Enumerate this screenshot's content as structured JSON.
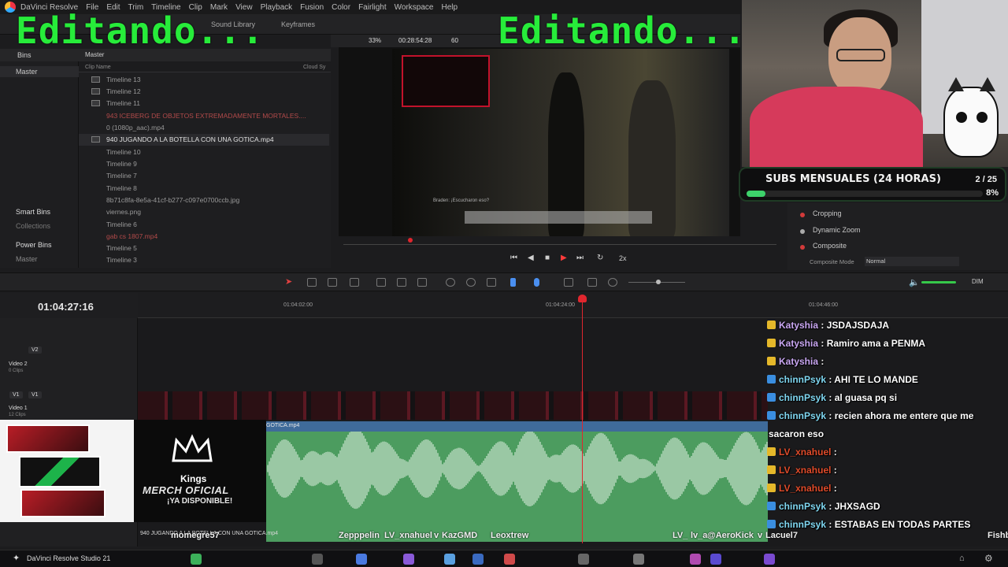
{
  "app": {
    "menu": [
      "DaVinci Resolve",
      "File",
      "Edit",
      "Trim",
      "Timeline",
      "Clip",
      "Mark",
      "View",
      "Playback",
      "Fusion",
      "Color",
      "Fairlight",
      "Workspace",
      "Help"
    ],
    "toolbar": {
      "sound_library": "Sound Library",
      "keyframes": "Keyframes"
    }
  },
  "media_pool": {
    "bins_label": "Bins",
    "master_bin": "Master",
    "smart_bins": "Smart Bins",
    "collections": "Collections",
    "power_bins": "Power Bins",
    "power_master": "Master",
    "header": "Master",
    "column_clip_name": "Clip Name",
    "column_cloud": "Cloud Sy",
    "clips": [
      "Timeline 13",
      "Timeline 12",
      "Timeline 11",
      "943 ICEBERG DE OBJETOS EXTREMADAMENTE MORTALES....",
      "0 (1080p_aac).mp4",
      "940 JUGANDO A LA BOTELLA CON UNA GOTICA.mp4",
      "Timeline 10",
      "Timeline 9",
      "Timeline 7",
      "Timeline 8",
      "8b71c8fa-8e5a-41cf-b277-c097e0700ccb.jpg",
      "viernes.png",
      "gab cs 1807.mp4",
      "Timeline 6",
      "Timeline 5",
      "Timeline 3"
    ]
  },
  "viewer": {
    "zoom": "33%",
    "timecode": "00:28:54:28",
    "fps": "60",
    "speed": "2x",
    "subtitle_line": "Braden: ¡Escucharon eso?"
  },
  "inspector": {
    "items": [
      "Cropping",
      "Dynamic Zoom",
      "Composite"
    ],
    "composite_mode_label": "Composite Mode",
    "composite_mode_value": "Normal"
  },
  "overlay": {
    "edit_text": "Editando...",
    "subs_title": "SUBS MENSUALES (24 HORAS)",
    "subs_count": "2 / 25",
    "subs_percent": "8%",
    "subs_fraction": 0.08
  },
  "timeline": {
    "timecode": "01:04:27:16",
    "ruler": [
      "01:04:02:00",
      "01:04:24:00",
      "01:04:46:00"
    ],
    "tracks": [
      {
        "badge": "V2",
        "name": "Video 2",
        "clips": "0 Clips"
      },
      {
        "badge": "V1",
        "name": "Video 1",
        "clips": "12 Clips"
      }
    ],
    "clip_title": "GOTICA.mp4",
    "bottom_clip": "940 JUGANDO A LA BOTELLA CON UNA GOTICA.mp4",
    "dim_label": "DIM"
  },
  "merch": {
    "brand": "Kings",
    "line1": "MERCH OFICIAL",
    "line2": "¡YA DISPONIBLE!"
  },
  "chat": [
    {
      "user": "Katyshia",
      "text": "JSDAJSDAJA",
      "color": "#c9a7f2"
    },
    {
      "user": "Katyshia",
      "text": "Ramiro ama a PENMA",
      "color": "#c9a7f2"
    },
    {
      "user": "Katyshia",
      "text": "",
      "color": "#c9a7f2"
    },
    {
      "user": "chinnPsyk",
      "text": "AHI TE LO MANDE",
      "color": "#7fd6f0"
    },
    {
      "user": "chinnPsyk",
      "text": "al guasa pq si",
      "color": "#7fd6f0"
    },
    {
      "user": "chinnPsyk",
      "text": "recien ahora me entere que me",
      "color": "#7fd6f0"
    },
    {
      "user": "",
      "text": "sacaron eso",
      "color": "#ffffff"
    },
    {
      "user": "LV_xnahuel",
      "text": "",
      "color": "#e04b2a"
    },
    {
      "user": "LV_xnahuel",
      "text": "",
      "color": "#e04b2a"
    },
    {
      "user": "LV_xnahuel",
      "text": "",
      "color": "#e04b2a"
    },
    {
      "user": "chinnPsyk",
      "text": "JHXSAGD",
      "color": "#7fd6f0"
    },
    {
      "user": "chinnPsyk",
      "text": "ESTABAS EN TODAS PARTES",
      "color": "#7fd6f0"
    }
  ],
  "marquee": [
    "momegre57",
    "Zepppelin",
    "LV_xnahuel",
    "v",
    "KazGMD",
    "Leoxtrew",
    "LV_",
    "lv_a",
    "@AeroKick",
    "v",
    "Lacuel7",
    "Fishb"
  ],
  "taskbar": {
    "app": "DaVinci Resolve Studio 21"
  }
}
